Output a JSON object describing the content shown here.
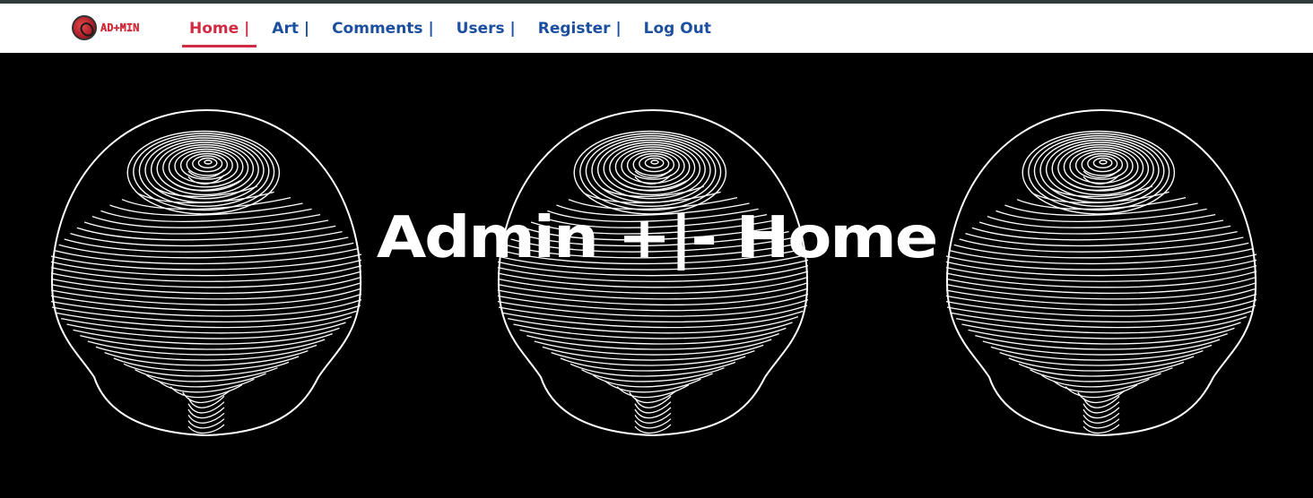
{
  "logo": {
    "text": "AD+MIN"
  },
  "nav": {
    "items": [
      {
        "label": "Home |",
        "active": true
      },
      {
        "label": "Art |",
        "active": false
      },
      {
        "label": "Comments |",
        "active": false
      },
      {
        "label": "Users |",
        "active": false
      },
      {
        "label": "Register |",
        "active": false
      },
      {
        "label": "Log Out",
        "active": false
      }
    ]
  },
  "hero": {
    "title": "Admin +|- Home",
    "background_color": "#000000",
    "pattern": "wireframe-contour-sphere",
    "pattern_count": 3
  },
  "colors": {
    "nav_link": "#1c4fa0",
    "nav_active": "#d02b43",
    "top_border": "#2f3b3b"
  }
}
